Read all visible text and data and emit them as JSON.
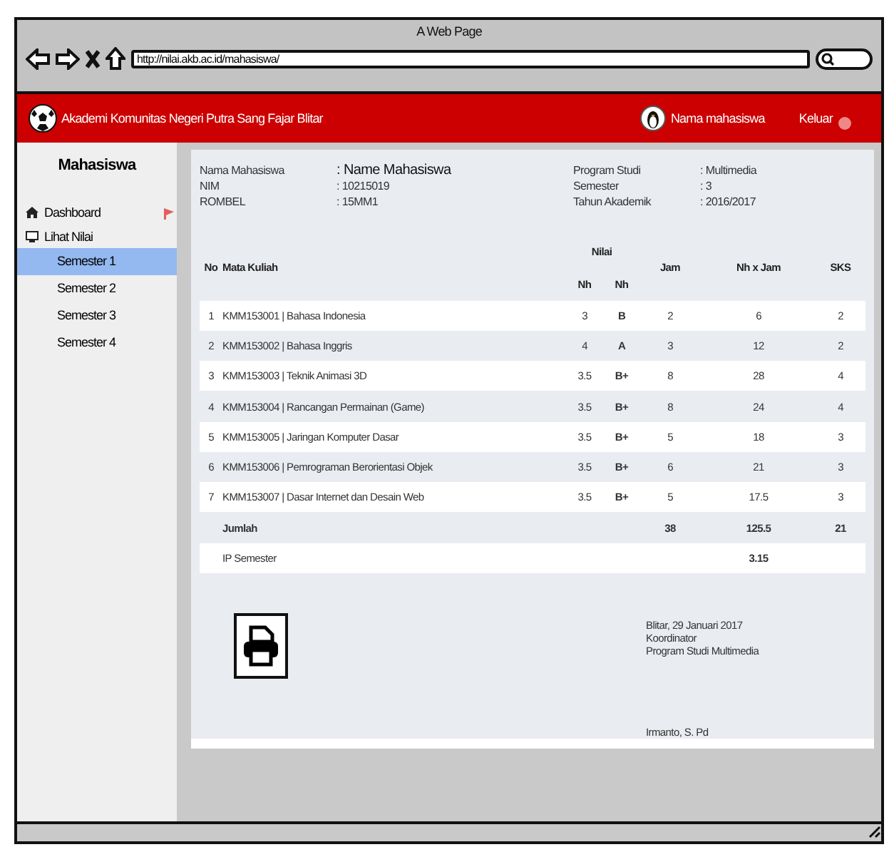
{
  "window": {
    "title": "A Web Page"
  },
  "browser": {
    "url": "http://nilai.akb.ac.id/mahasiswa/"
  },
  "header": {
    "brand": "Akademi Komunitas Negeri Putra Sang Fajar Blitar",
    "user": "Nama mahasiswa",
    "logout": "Keluar"
  },
  "sidebar": {
    "title": "Mahasiswa",
    "items": [
      {
        "label": "Dashboard",
        "kind": "home"
      },
      {
        "label": "Lihat Nilai",
        "kind": "monitor",
        "children": [
          {
            "label": "Semester 1",
            "selected": true
          },
          {
            "label": "Semester 2",
            "selected": false
          },
          {
            "label": "Semester 3",
            "selected": false
          },
          {
            "label": "Semester 4",
            "selected": false
          }
        ]
      }
    ]
  },
  "student_info": {
    "left": [
      {
        "label": "Nama Mahasiswa",
        "value": ": Name Mahasiswa"
      },
      {
        "label": "NIM",
        "value": ": 10215019"
      },
      {
        "label": "ROMBEL",
        "value": ": 15MM1"
      }
    ],
    "right": [
      {
        "label": "Program Studi",
        "value": ": Multimedia"
      },
      {
        "label": "Semester",
        "value": ": 3"
      },
      {
        "label": "Tahun Akademik",
        "value": ": 2016/2017"
      }
    ]
  },
  "table": {
    "columns": {
      "no": "No",
      "course": "Mata Kuliah",
      "grade_group": "Nilai",
      "nh": "Nh",
      "nh2": "Nh",
      "hours": "Jam",
      "product": "Nh x Jam",
      "credits": "SKS"
    },
    "rows": [
      {
        "no": "1",
        "course": "KMM153001 | Bahasa Indonesia",
        "nh": "3",
        "grade": "B",
        "hours": "2",
        "product": "6",
        "credits": "2"
      },
      {
        "no": "2",
        "course": "KMM153002 | Bahasa Inggris",
        "nh": "4",
        "grade": "A",
        "hours": "3",
        "product": "12",
        "credits": "2"
      },
      {
        "no": "3",
        "course": "KMM153003 | Teknik Animasi 3D",
        "nh": "3.5",
        "grade": "B+",
        "hours": "8",
        "product": "28",
        "credits": "4"
      },
      {
        "no": "4",
        "course": "KMM153004 | Rancangan Permainan (Game)",
        "nh": "3.5",
        "grade": "B+",
        "hours": "8",
        "product": "24",
        "credits": "4"
      },
      {
        "no": "5",
        "course": "KMM153005 | Jaringan Komputer Dasar",
        "nh": "3.5",
        "grade": "B+",
        "hours": "5",
        "product": "18",
        "credits": "3"
      },
      {
        "no": "6",
        "course": "KMM153006 | Pemrograman Berorientasi Objek",
        "nh": "3.5",
        "grade": "B+",
        "hours": "6",
        "product": "21",
        "credits": "3"
      },
      {
        "no": "7",
        "course": "KMM153007 | Dasar Internet dan Desain Web",
        "nh": "3.5",
        "grade": "B+",
        "hours": "5",
        "product": "17.5",
        "credits": "3"
      }
    ],
    "total": {
      "label": "Jumlah",
      "hours": "38",
      "product": "125.5",
      "credits": "21"
    },
    "ip": {
      "label": "IP Semester",
      "value": "3.15"
    }
  },
  "signature": {
    "lines": [
      "Blitar, 29 Januari 2017",
      "Koordinator",
      "Program Studi Multimedia"
    ],
    "name": "Irmanto, S. Pd"
  }
}
